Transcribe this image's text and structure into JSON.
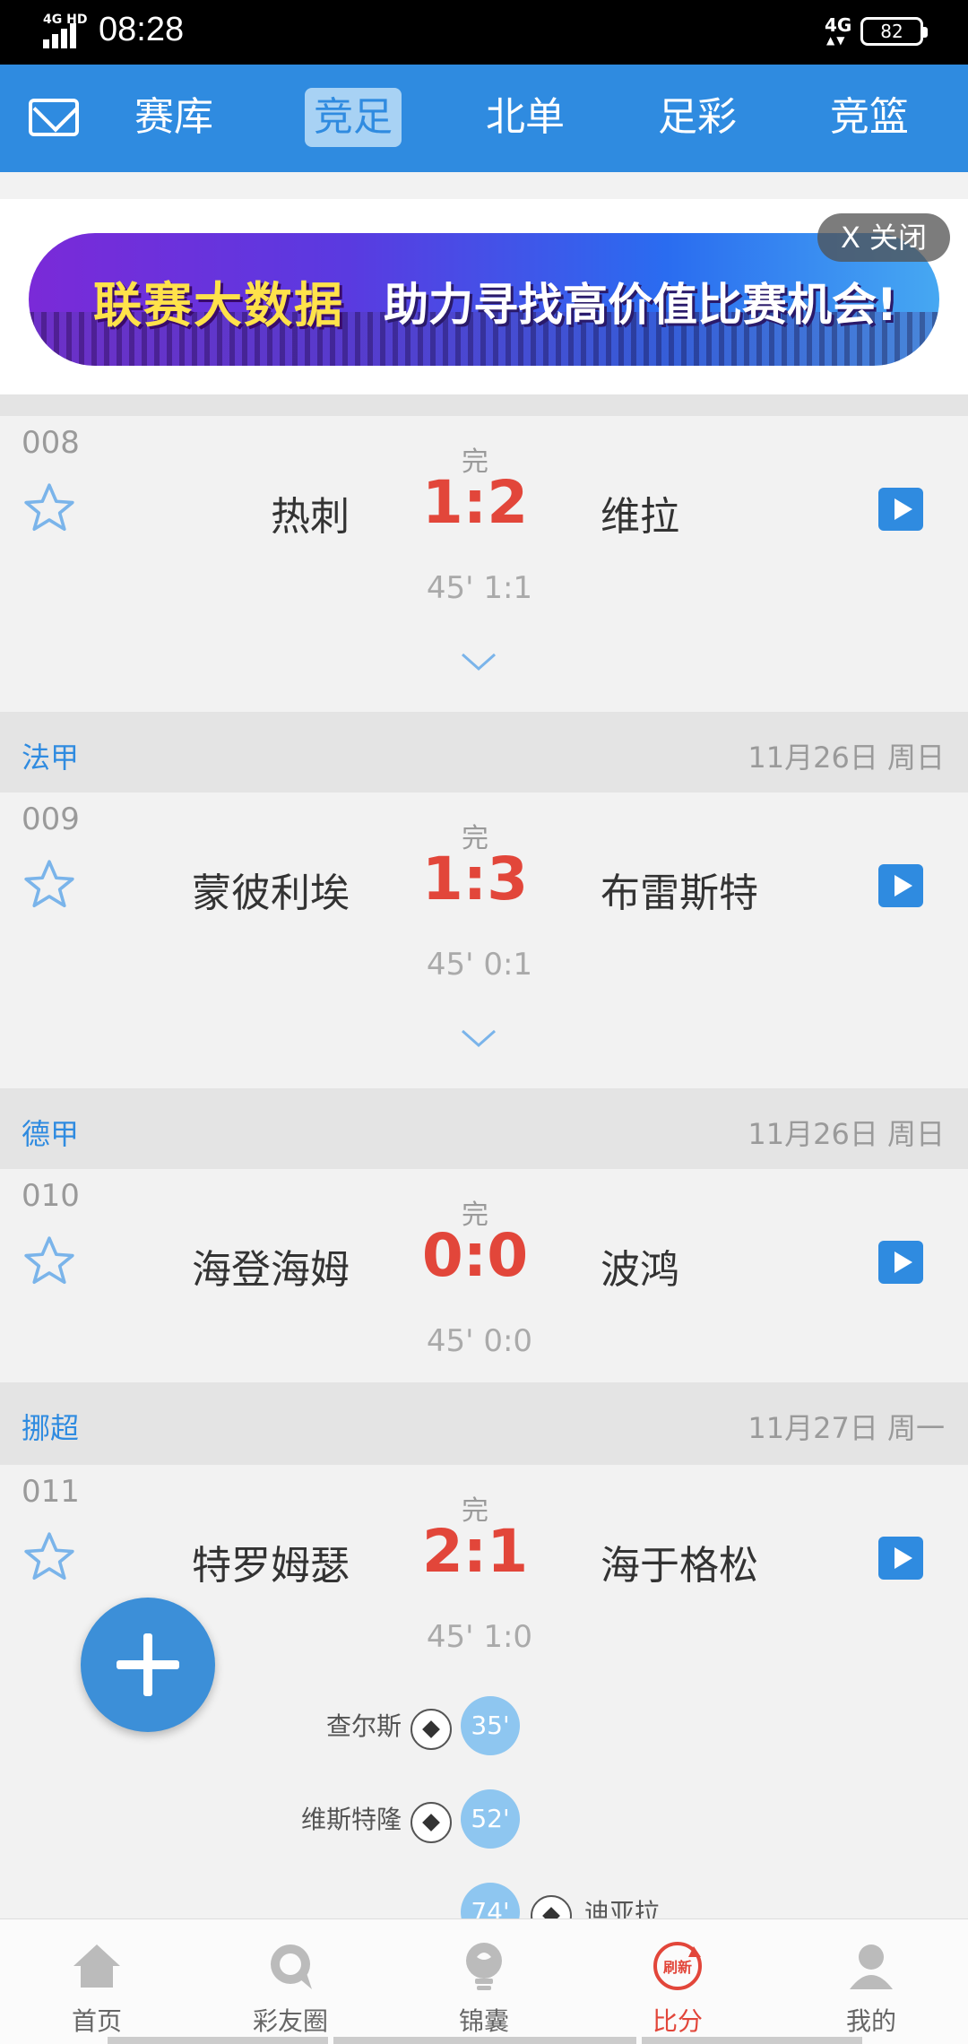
{
  "status_bar": {
    "network": "4G HD",
    "time": "08:28",
    "network_right": "4G",
    "battery": "82"
  },
  "top_nav": {
    "tabs": [
      {
        "label": "赛库"
      },
      {
        "label": "竞足",
        "active": true
      },
      {
        "label": "北单"
      },
      {
        "label": "足彩"
      },
      {
        "label": "竞篮"
      }
    ]
  },
  "banner": {
    "text_main": "联赛大数据",
    "text_sub": "助力寻找高价值比赛机会!",
    "close_label": "X 关闭"
  },
  "matches": [
    {
      "no": "008",
      "status": "完",
      "home": "热刺",
      "score": "1:2",
      "away": "维拉",
      "half": "45' 1:1"
    },
    {
      "league": "法甲",
      "date": "11月26日 周日",
      "no": "009",
      "status": "完",
      "home": "蒙彼利埃",
      "score": "1:3",
      "away": "布雷斯特",
      "half": "45' 0:1"
    },
    {
      "league": "德甲",
      "date": "11月26日 周日",
      "no": "010",
      "status": "完",
      "home": "海登海姆",
      "score": "0:0",
      "away": "波鸿",
      "half": "45' 0:0"
    },
    {
      "league": "挪超",
      "date": "11月27日 周一",
      "no": "011",
      "status": "完",
      "home": "特罗姆瑟",
      "score": "2:1",
      "away": "海于格松",
      "half": "45' 1:0",
      "goals": [
        {
          "player": "查尔斯",
          "minute": "35'",
          "side": "home"
        },
        {
          "player": "维斯特隆",
          "minute": "52'",
          "side": "home"
        },
        {
          "player": "迪亚拉",
          "minute": "74'",
          "side": "away"
        }
      ]
    }
  ],
  "bottom_nav": {
    "items": [
      {
        "label": "首页",
        "icon": "home-icon"
      },
      {
        "label": "彩友圈",
        "icon": "chat-bubble-icon"
      },
      {
        "label": "锦囊",
        "icon": "lightbulb-icon"
      },
      {
        "label": "比分",
        "icon": "refresh-score-icon",
        "active": true,
        "icon_text": "刷新"
      },
      {
        "label": "我的",
        "icon": "profile-icon"
      }
    ]
  },
  "colors": {
    "primary": "#2f8be0",
    "score_red": "#e2463a",
    "muted": "#9a9a9a"
  }
}
